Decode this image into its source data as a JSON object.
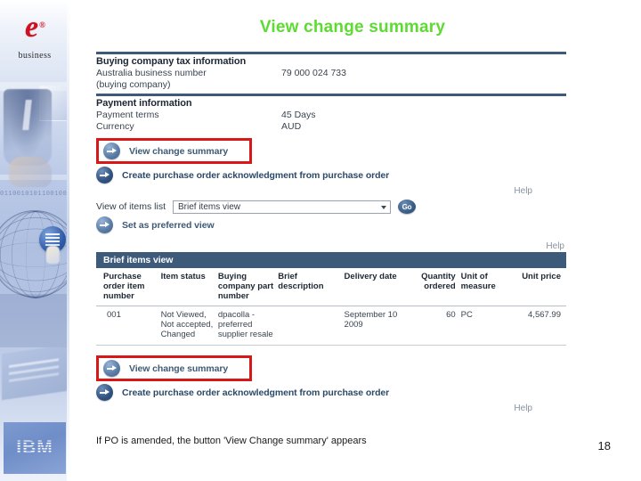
{
  "slide": {
    "title": "View change summary",
    "title_color": "#5ddb33",
    "caption": "If PO is amended, the button 'View Change summary' appears",
    "page_number": "18"
  },
  "branding": {
    "logo_mark": "e",
    "logo_registered": "®",
    "logo_word": "business",
    "footer_logo": "IBM"
  },
  "capture": {
    "tax_section": {
      "heading": "Buying company tax information",
      "rows": [
        {
          "label": "Australia business number (buying company)",
          "value": "79 000 024 733"
        }
      ]
    },
    "payment_section": {
      "heading": "Payment information",
      "rows": [
        {
          "label": "Payment terms",
          "value": "45 Days"
        },
        {
          "label": "Currency",
          "value": "AUD"
        }
      ]
    },
    "top_actions": {
      "view_change_summary": "View change summary",
      "create_poa": "Create purchase order acknowledgment from purchase order",
      "help": "Help"
    },
    "view_selector": {
      "label": "View of items list",
      "selected": "Brief items view",
      "go_label": "Go",
      "set_preferred": "Set as preferred view"
    },
    "table_help": "Help",
    "table": {
      "title": "Brief items view",
      "columns": [
        "Purchase order item number",
        "Item status",
        "Buying company part number",
        "Brief description",
        "Delivery date",
        "Quantity ordered",
        "Unit of measure",
        "Unit price"
      ],
      "rows": [
        {
          "item_number": "001",
          "item_status": "Not Viewed, Not accepted, Changed",
          "part_number": "dpacolla - preferred supplier resale",
          "description": "",
          "delivery_date": "September 10 2009",
          "quantity": "60",
          "uom": "PC",
          "unit_price": "4,567.99"
        }
      ]
    },
    "bottom_actions": {
      "view_change_summary": "View change summary",
      "create_poa": "Create purchase order acknowledgment from purchase order",
      "help": "Help"
    },
    "colors": {
      "header_bar": "#3d5a7a",
      "link_text": "#3f5a77",
      "annotation_box": "#d81717"
    }
  }
}
